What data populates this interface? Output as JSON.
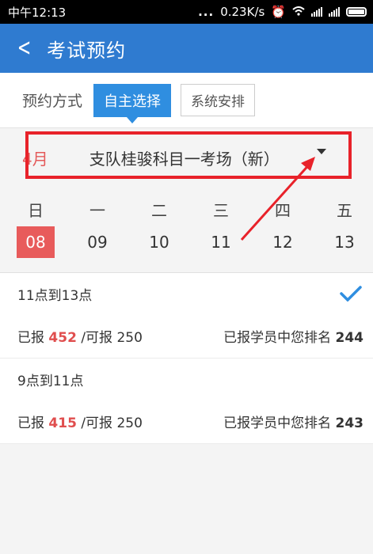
{
  "status": {
    "time": "中午12:13",
    "dots": "...",
    "speed": "0.23K/s"
  },
  "header": {
    "back_icon": "chevron-left-icon",
    "title": "考试预约"
  },
  "mode": {
    "label": "预约方式",
    "selected": "自主选择",
    "other": "系统安排"
  },
  "venue": {
    "month": "4月",
    "name": "支队桂骏科目一考场（新）"
  },
  "week": {
    "days": [
      "日",
      "一",
      "二",
      "三",
      "四",
      "五"
    ],
    "dates": [
      "08",
      "09",
      "10",
      "11",
      "12",
      "13"
    ],
    "selected_index": 0
  },
  "slots": [
    {
      "time": "11点到13点",
      "reported_label": "已报",
      "reported": "452",
      "capacity_label": "/可报",
      "capacity": "250",
      "rank_label": "已报学员中您排名",
      "rank": "244",
      "checked": true
    },
    {
      "time": "9点到11点",
      "reported_label": "已报",
      "reported": "415",
      "capacity_label": "/可报",
      "capacity": "250",
      "rank_label": "已报学员中您排名",
      "rank": "243",
      "checked": false
    }
  ],
  "colors": {
    "accent": "#2f7bd0",
    "highlight": "#e8222a",
    "selected_date": "#e85b5b"
  }
}
